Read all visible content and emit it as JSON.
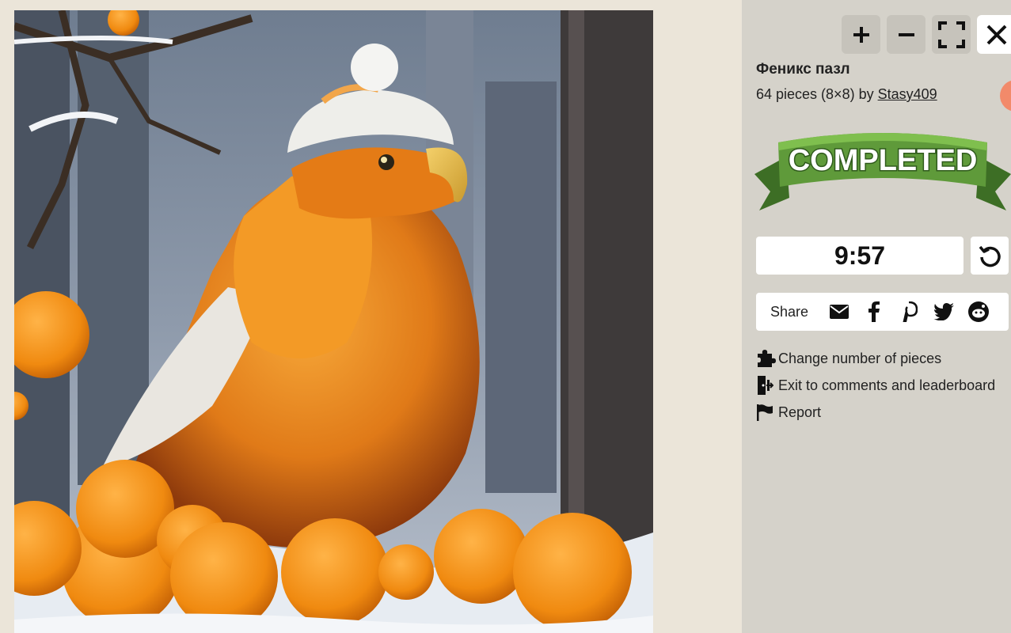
{
  "controls": {
    "zoom_in_icon": "plus-icon",
    "zoom_out_icon": "minus-icon",
    "fullscreen_icon": "fullscreen-icon",
    "close_icon": "close-icon"
  },
  "puzzle": {
    "title": "Феникс пазл",
    "pieces_text": "64 pieces (8×8) by",
    "author": "Stasy409",
    "status_banner": "COMPLETED"
  },
  "timer": {
    "value": "9:57"
  },
  "share": {
    "label": "Share",
    "icons": [
      "email-icon",
      "facebook-icon",
      "pinterest-icon",
      "twitter-icon",
      "reddit-icon"
    ]
  },
  "links": [
    {
      "label": "Change number of pieces",
      "icon": "puzzle-piece-icon"
    },
    {
      "label": "Exit to comments and leaderboard",
      "icon": "exit-door-icon"
    },
    {
      "label": "Report",
      "icon": "flag-icon"
    }
  ],
  "colors": {
    "panel_bg": "#d5d2ca",
    "page_bg": "#ebe5d9",
    "button_bg": "#c6c3bb",
    "banner_green": "#5f9a3a",
    "banner_dark_green": "#3d6e25"
  }
}
